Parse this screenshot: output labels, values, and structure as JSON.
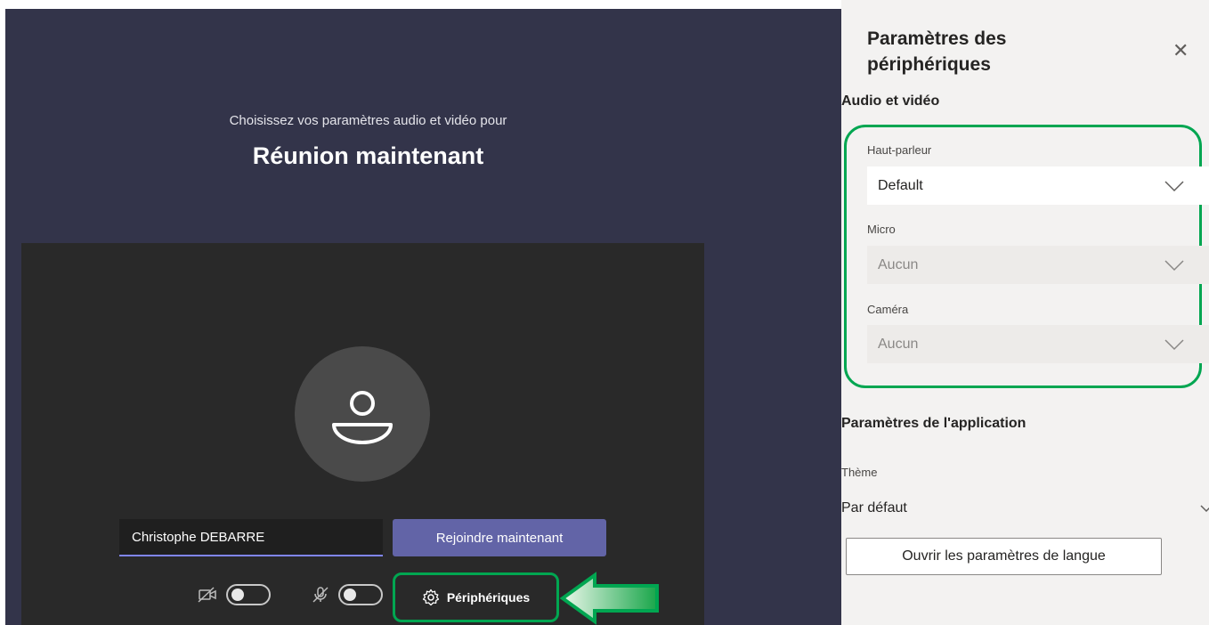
{
  "prejoin": {
    "subtitle": "Choisissez vos paramètres audio et vidéo pour",
    "meeting_title": "Réunion maintenant",
    "name_value": "Christophe DEBARRE",
    "join_label": "Rejoindre maintenant",
    "video_toggle_on": false,
    "mic_toggle_on": false,
    "devices_label": "Périphériques"
  },
  "panel": {
    "title_line1": "Paramètres des",
    "title_line2": "périphériques",
    "audio_video_heading": "Audio et vidéo",
    "speaker": {
      "label": "Haut-parleur",
      "value": "Default"
    },
    "mic": {
      "label": "Micro",
      "value": "Aucun"
    },
    "camera": {
      "label": "Caméra",
      "value": "Aucun"
    },
    "app_settings_heading": "Paramètres de l'application",
    "theme": {
      "label": "Thème",
      "value": "Par défaut"
    },
    "language_button": "Ouvrir les paramètres de langue"
  },
  "colors": {
    "accent": "#6264a7",
    "highlight": "#00a651",
    "background": "#33344a"
  }
}
